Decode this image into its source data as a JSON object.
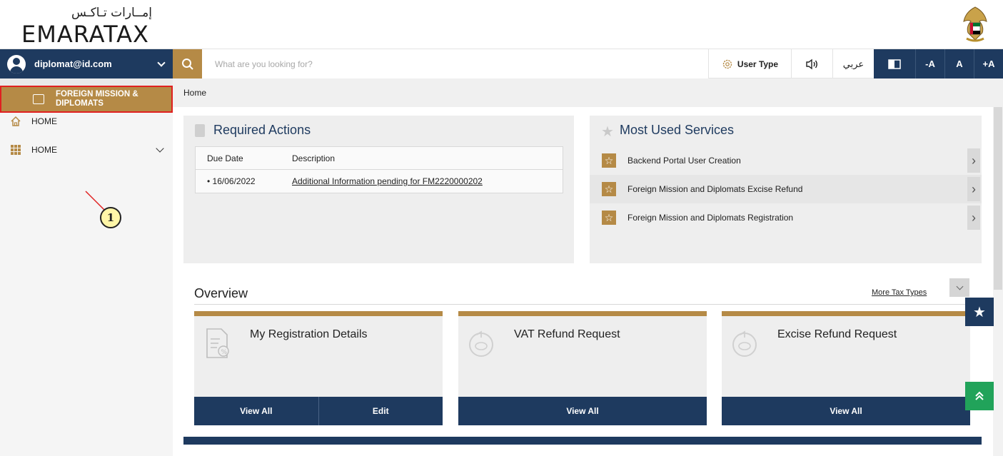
{
  "logo": {
    "arabic": "إمــارات تـاكـس",
    "english": "EMARATAX"
  },
  "toolbar": {
    "user_email": "diplomat@id.com",
    "search_placeholder": "What are you looking for?",
    "user_type_label": "User Type",
    "arabic_label": "عربي",
    "font_decrease": "-A",
    "font_normal": "A",
    "font_increase": "+A"
  },
  "sidebar": {
    "items": [
      {
        "label": "HOME",
        "icon": "house-icon"
      },
      {
        "label": "HOME",
        "icon": "grid-icon"
      }
    ],
    "active_item": "FOREIGN MISSION & DIPLOMATS",
    "callout_number": "1"
  },
  "breadcrumb": "Home",
  "required_actions": {
    "title": "Required Actions",
    "headers": [
      "Due Date",
      "Description"
    ],
    "rows": [
      {
        "date": "• 16/06/2022",
        "description": "Additional Information pending for FM2220000202"
      }
    ]
  },
  "most_used": {
    "title": "Most Used Services",
    "items": [
      "Backend Portal User Creation",
      "Foreign Mission and Diplomats Excise Refund",
      "Foreign Mission and Diplomats Registration"
    ]
  },
  "overview": {
    "title": "Overview",
    "more_link": "More Tax Types",
    "cards": [
      {
        "title": "My Registration Details",
        "buttons": [
          "View All",
          "Edit"
        ]
      },
      {
        "title": "VAT Refund Request",
        "buttons": [
          "View All"
        ]
      },
      {
        "title": "Excise Refund Request",
        "buttons": [
          "View All"
        ]
      }
    ]
  },
  "colors": {
    "navy": "#1e3a5f",
    "gold": "#b58a46",
    "green": "#21a35a",
    "callout_red": "#e02020"
  }
}
